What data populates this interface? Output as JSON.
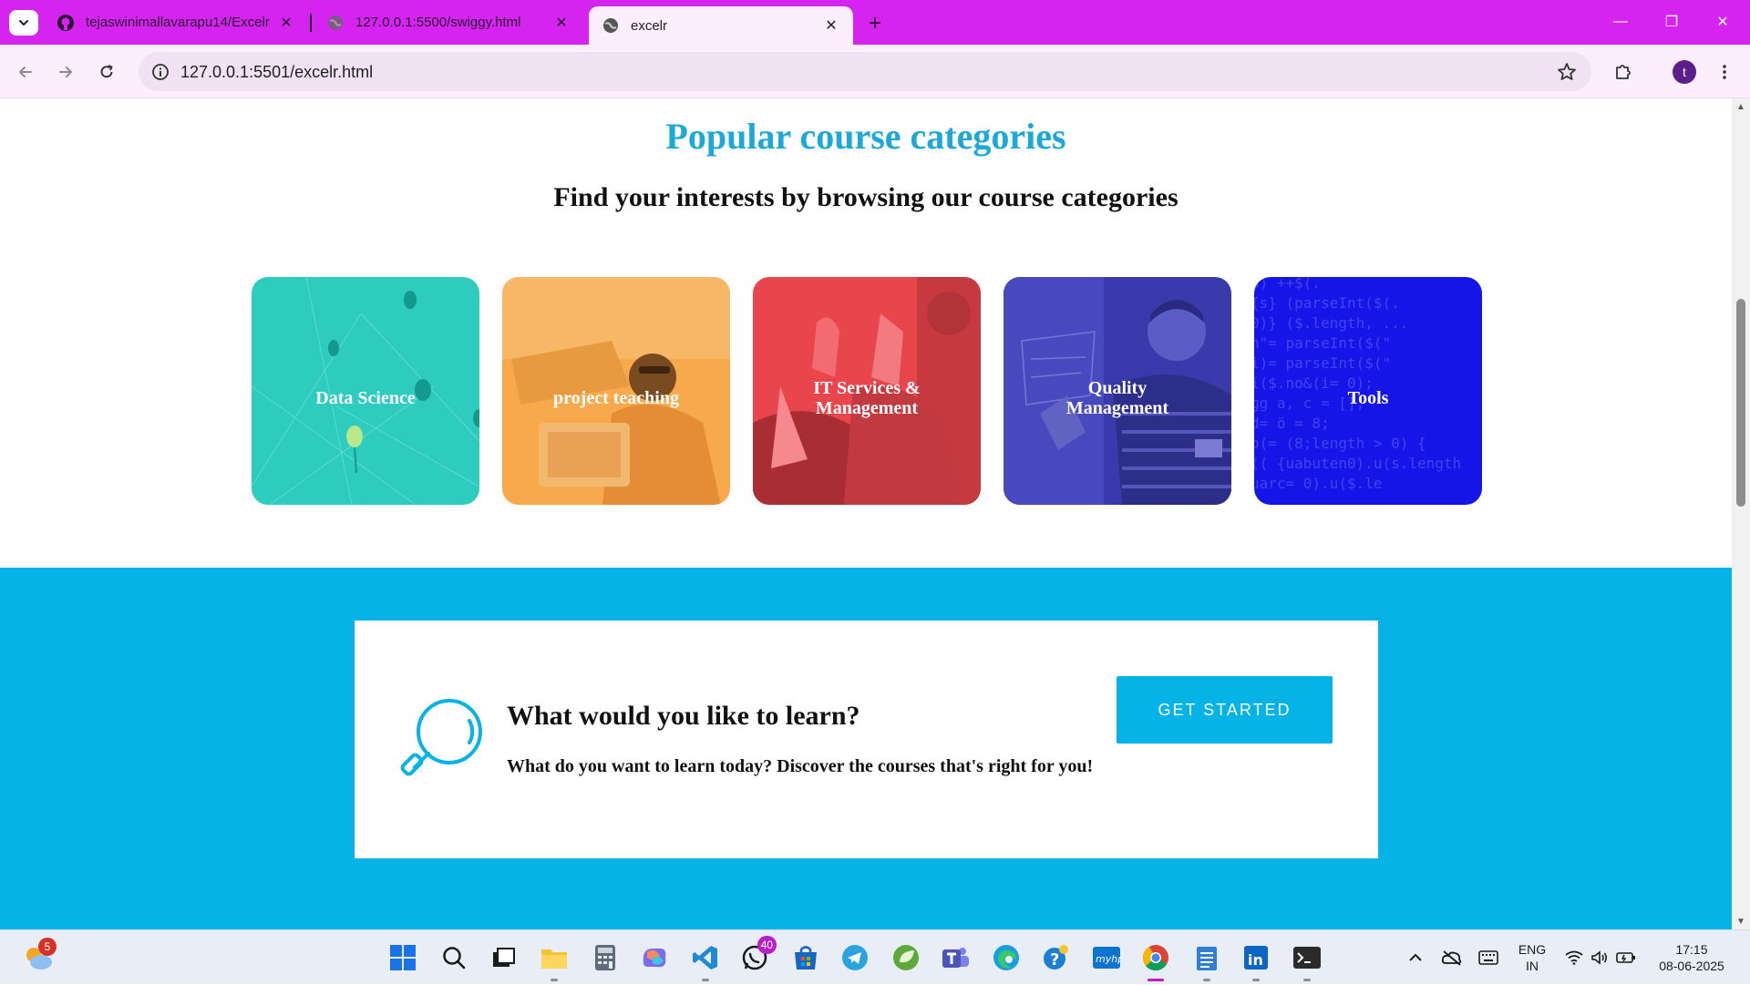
{
  "browser": {
    "tabs": [
      {
        "title": "tejaswinimallavarapu14/Excelr-",
        "icon": "github-icon"
      },
      {
        "title": "127.0.0.1:5500/swiggy.html",
        "icon": "globe-icon"
      },
      {
        "title": "excelr",
        "icon": "globe-icon",
        "active": true
      }
    ],
    "url": "127.0.0.1:5501/excelr.html",
    "profile_initial": "t"
  },
  "page": {
    "title": "Popular course categories",
    "subtitle": "Find your interests by browsing our course categories",
    "categories": [
      {
        "label": "Data Science",
        "color": "#2ecbbf"
      },
      {
        "label": "project teaching",
        "color": "#f8a94c"
      },
      {
        "label": "IT Services & Management",
        "color": "#e8464c"
      },
      {
        "label": "Quality Management",
        "color": "#3a3aad"
      },
      {
        "label": "Tools",
        "color": "#1515e8"
      }
    ],
    "cta": {
      "question": "What would you like to learn?",
      "description": "What do you want to learn today? Discover the courses that's right for you!",
      "button": "GET STARTED",
      "accent": "#06b3e6"
    }
  },
  "taskbar": {
    "weather_badge": "5",
    "whatsapp_badge": "40",
    "lang_top": "ENG",
    "lang_bottom": "IN",
    "time": "17:15",
    "date": "08-06-2025"
  }
}
